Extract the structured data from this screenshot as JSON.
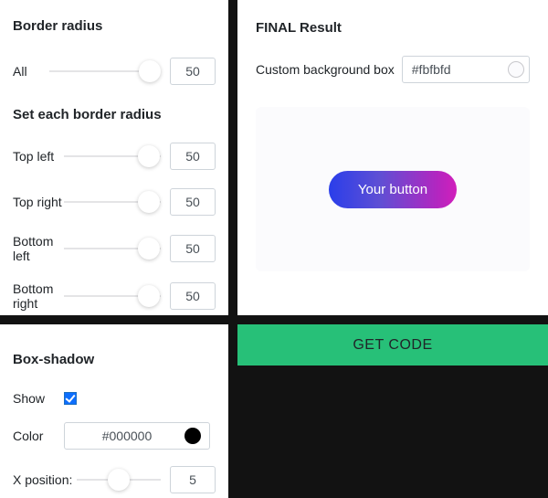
{
  "borderRadius": {
    "heading": "Border radius",
    "allValue": "50",
    "allThumbPct": "90",
    "subheading": "Set each border radius",
    "corners": {
      "topLeft": {
        "label": "Top left",
        "value": "50",
        "thumbPct": "88"
      },
      "topRight": {
        "label": "Top right",
        "value": "50",
        "thumbPct": "88"
      },
      "bottomLeft": {
        "label": "Bottom left",
        "value": "50",
        "thumbPct": "88"
      },
      "bottomRight": {
        "label": "Bottom right",
        "value": "50",
        "thumbPct": "88"
      }
    }
  },
  "boxShadow": {
    "heading": "Box-shadow",
    "showLabel": "Show",
    "colorLabel": "Color",
    "colorValue": "#000000",
    "colorSwatch": "#000000",
    "xpos": {
      "label": "X position:",
      "value": "5",
      "thumbPct": "50"
    }
  },
  "result": {
    "title": "FINAL Result",
    "bgLabel": "Custom background box",
    "bgValue": "#fbfbfd",
    "bgSwatch": "#fbfbfd",
    "buttonText": "Your button",
    "previewBg": "#fbfbfd"
  },
  "getCode": {
    "label": "GET CODE",
    "bg": "#27c078"
  }
}
